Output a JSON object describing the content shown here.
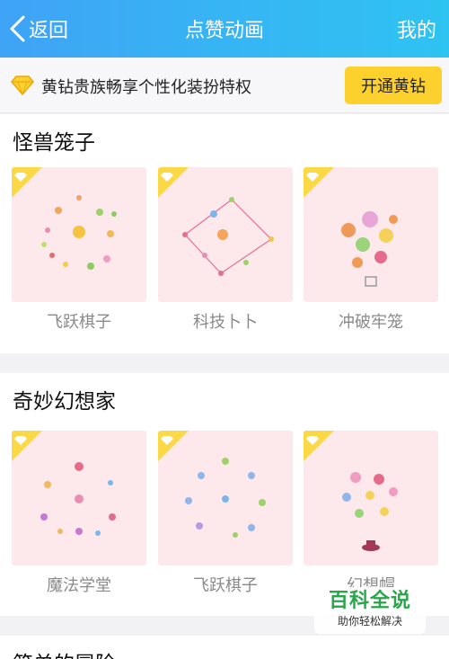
{
  "header": {
    "back_label": "返回",
    "title": "点赞动画",
    "mine_label": "我的"
  },
  "vip_bar": {
    "text": "黄钻贵族畅享个性化装扮特权",
    "button_label": "开通黄钻",
    "icon": "diamond-icon"
  },
  "sections": [
    {
      "title": "怪兽笼子",
      "items": [
        {
          "label": "飞跃棋子",
          "badge": "vip-diamond"
        },
        {
          "label": "科技卜卜",
          "badge": "vip-diamond"
        },
        {
          "label": "冲破牢笼",
          "badge": "vip-diamond"
        }
      ]
    },
    {
      "title": "奇妙幻想家",
      "items": [
        {
          "label": "魔法学堂",
          "badge": "vip-diamond"
        },
        {
          "label": "飞跃棋子",
          "badge": "vip-diamond"
        },
        {
          "label": "幻想帽",
          "badge": "vip-diamond"
        }
      ]
    },
    {
      "title": "简单的冒险"
    }
  ],
  "watermark": {
    "main": "百科全说",
    "sub": "助你轻松解决"
  },
  "colors": {
    "header_gradient_start": "#3fa3f6",
    "header_gradient_end": "#2ec3f1",
    "vip_button": "#fcd12e",
    "thumb_bg": "#fde9ec",
    "watermark_green": "#2aa64a"
  }
}
